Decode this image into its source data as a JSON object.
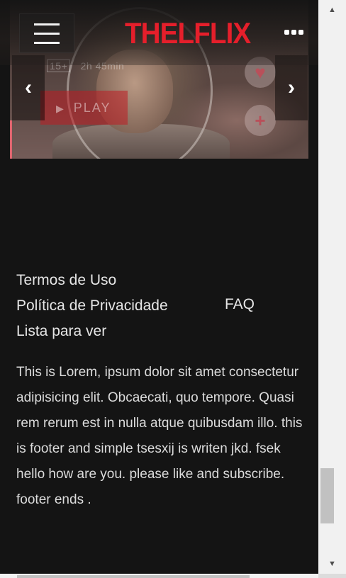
{
  "header": {
    "logo": "THELFLIX",
    "menu_icon": "hamburger-menu-icon",
    "more_icon": "more-options-icon"
  },
  "hero": {
    "rating_badge": "15+",
    "duration": "2h 45min",
    "play_label": "PLAY",
    "prev_symbol": "‹",
    "next_symbol": "›",
    "heart_symbol": "♥",
    "plus_symbol": "+"
  },
  "footer": {
    "links": [
      "Termos de Uso",
      "Política de Privacidade",
      "Lista para ver"
    ],
    "faq": "FAQ",
    "text": "This is Lorem, ipsum dolor sit amet consectetur adipisicing elit. Obcaecati, quo tempore. Quasi rem rerum est in nulla atque quibusdam illo. this is footer and simple tsesxij is writen jkd. fsek hello how are you. please like and subscribe. footer ends ."
  },
  "scrollbar": {
    "up_symbol": "▲",
    "down_symbol": "▼"
  },
  "colors": {
    "brand": "#e51f2b",
    "background": "#141414",
    "text": "#e6e6e6"
  }
}
